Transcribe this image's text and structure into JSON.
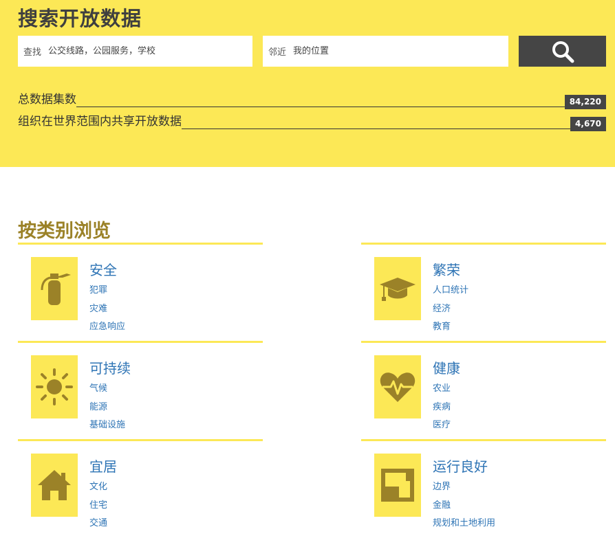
{
  "hero": {
    "title": "搜索开放数据",
    "search": {
      "query_label": "查找",
      "query_placeholder": "公交线路，公园服务，学校",
      "near_label": "邻近",
      "near_placeholder": "我的位置"
    },
    "stats": [
      {
        "label": "总数据集数",
        "value": "84,220"
      },
      {
        "label": "组织在世界范围内共享开放数据",
        "value": "4,670"
      }
    ]
  },
  "browse": {
    "title": "按类别浏览",
    "categories": [
      {
        "title": "安全",
        "icon": "fire-extinguisher-icon",
        "items": [
          "犯罪",
          "灾难",
          "应急响应"
        ]
      },
      {
        "title": "繁荣",
        "icon": "graduation-cap-icon",
        "items": [
          "人口统计",
          "经济",
          "教育"
        ]
      },
      {
        "title": "可持续",
        "icon": "sun-icon",
        "items": [
          "气候",
          "能源",
          "基础设施"
        ]
      },
      {
        "title": "健康",
        "icon": "heartbeat-icon",
        "items": [
          "农业",
          "疾病",
          "医疗"
        ]
      },
      {
        "title": "宜居",
        "icon": "house-icon",
        "items": [
          "文化",
          "住宅",
          "交通"
        ]
      },
      {
        "title": "运行良好",
        "icon": "floor-plan-icon",
        "items": [
          "边界",
          "金融",
          "规划和土地利用"
        ]
      }
    ]
  },
  "colors": {
    "accent_yellow": "#fce856",
    "dark_gray": "#454545",
    "link_blue": "#2e74b5",
    "heading_gold": "#9b8228",
    "icon_gold": "#9b8228"
  }
}
